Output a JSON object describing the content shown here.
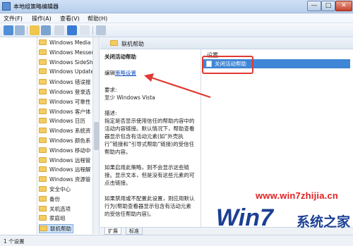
{
  "window": {
    "title": "本地组策略编辑器",
    "min": "—",
    "max": "□",
    "close": "✕"
  },
  "menu": [
    "文件(F)",
    "操作(A)",
    "查看(V)",
    "帮助(H)"
  ],
  "tree": {
    "items": [
      {
        "label": "Windows Media"
      },
      {
        "label": "Windows Messen"
      },
      {
        "label": "Windows SideSh"
      },
      {
        "label": "Windows Update"
      },
      {
        "label": "Windows 错误报"
      },
      {
        "label": "Windows 登录选"
      },
      {
        "label": "Windows 可靠性"
      },
      {
        "label": "Windows 客户体"
      },
      {
        "label": "Windows 日历"
      },
      {
        "label": "Windows 系统资"
      },
      {
        "label": "Windows 颜色系"
      },
      {
        "label": "Windows 移动中"
      },
      {
        "label": "Windows 远程管"
      },
      {
        "label": "Windows 远程解"
      },
      {
        "label": "Windows 资源管"
      },
      {
        "label": "安全中心"
      },
      {
        "label": "备份"
      },
      {
        "label": "关机选项"
      },
      {
        "label": "家庭组"
      },
      {
        "label": "联机帮助"
      }
    ],
    "selected_index": 19
  },
  "panel_header": "联机帮助",
  "desc": {
    "title": "关闭活动帮助",
    "edit_prefix": "编辑",
    "edit_link": "策略设置",
    "req_label": "要求:",
    "req_value": "至少 Windows Vista",
    "desc_label": "描述:",
    "desc_text": "指定是否显示使用信任的帮助内容中的活动内容链接。默认情况下，帮助查看器显示包含有活动元素(如“外壳执行”链接和“引导式帮助”链接)的受信任帮助内容。",
    "enabled_text": "如果启用此策略，则不会显示这些链接。显示文本，但是没有这些元素的可点击链接。",
    "disabled_text": "如果禁用或不配置此设置，则应用默认行为(帮助查看器显示包含有活动元素的受信任帮助内容)。"
  },
  "settings": {
    "column": "设置",
    "rows": [
      {
        "label": "关闭活动帮助"
      }
    ]
  },
  "tabs": [
    "扩展",
    "标准"
  ],
  "status": "1 个设置",
  "watermark": {
    "url": "www.win7zhijia.cn",
    "logo_text": "Win7",
    "brand": "系统之家"
  },
  "colors": {
    "selection": "#3f86d6",
    "annotation": "#e03a33",
    "link": "#1a55c0"
  }
}
